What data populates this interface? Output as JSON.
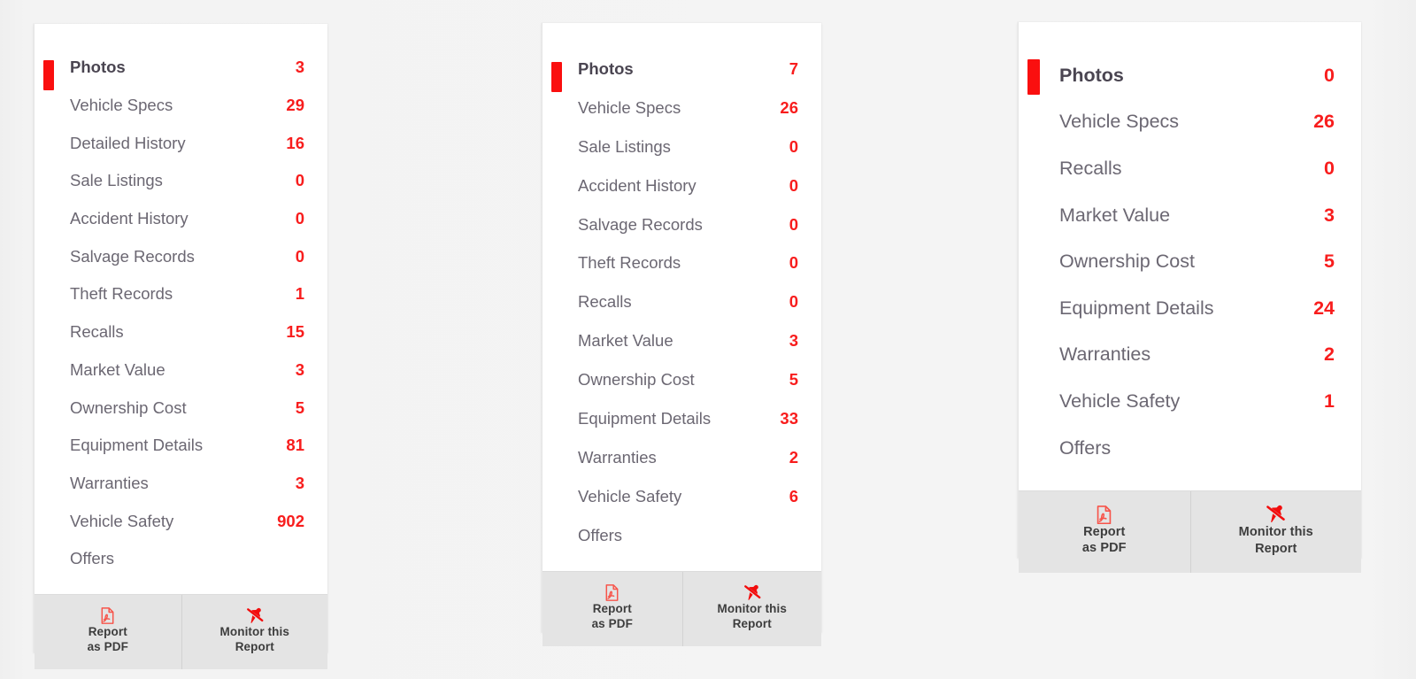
{
  "colors": {
    "accent_red": "#f81d1d",
    "marker_red": "#fa0f0f",
    "label_gray": "#6b6772",
    "active_label": "#4a4551",
    "panel_bg": "#ffffff",
    "page_bg": "#f2f2f2",
    "footer_bg": "#e4e4e4"
  },
  "footer": {
    "pdf": {
      "icon": "pdf-file-icon",
      "line1": "Report",
      "line2": "as PDF"
    },
    "monitor": {
      "icon": "pin-slash-icon",
      "line1": "Monitor this",
      "line2": "Report"
    }
  },
  "panels": [
    {
      "id": "panel-1",
      "active_index": 0,
      "rows": [
        {
          "label": "Photos",
          "count": "3"
        },
        {
          "label": "Vehicle Specs",
          "count": "29"
        },
        {
          "label": "Detailed History",
          "count": "16"
        },
        {
          "label": "Sale Listings",
          "count": "0"
        },
        {
          "label": "Accident History",
          "count": "0"
        },
        {
          "label": "Salvage Records",
          "count": "0"
        },
        {
          "label": "Theft Records",
          "count": "1"
        },
        {
          "label": "Recalls",
          "count": "15"
        },
        {
          "label": "Market Value",
          "count": "3"
        },
        {
          "label": "Ownership Cost",
          "count": "5"
        },
        {
          "label": "Equipment Details",
          "count": "81"
        },
        {
          "label": "Warranties",
          "count": "3"
        },
        {
          "label": "Vehicle Safety",
          "count": "902"
        },
        {
          "label": "Offers",
          "count": ""
        }
      ]
    },
    {
      "id": "panel-2",
      "active_index": 0,
      "rows": [
        {
          "label": "Photos",
          "count": "7"
        },
        {
          "label": "Vehicle Specs",
          "count": "26"
        },
        {
          "label": "Sale Listings",
          "count": "0"
        },
        {
          "label": "Accident History",
          "count": "0"
        },
        {
          "label": "Salvage Records",
          "count": "0"
        },
        {
          "label": "Theft Records",
          "count": "0"
        },
        {
          "label": "Recalls",
          "count": "0"
        },
        {
          "label": "Market Value",
          "count": "3"
        },
        {
          "label": "Ownership Cost",
          "count": "5"
        },
        {
          "label": "Equipment Details",
          "count": "33"
        },
        {
          "label": "Warranties",
          "count": "2"
        },
        {
          "label": "Vehicle Safety",
          "count": "6"
        },
        {
          "label": "Offers",
          "count": ""
        }
      ]
    },
    {
      "id": "panel-3",
      "active_index": 0,
      "rows": [
        {
          "label": "Photos",
          "count": "0"
        },
        {
          "label": "Vehicle Specs",
          "count": "26"
        },
        {
          "label": "Recalls",
          "count": "0"
        },
        {
          "label": "Market Value",
          "count": "3"
        },
        {
          "label": "Ownership Cost",
          "count": "5"
        },
        {
          "label": "Equipment Details",
          "count": "24"
        },
        {
          "label": "Warranties",
          "count": "2"
        },
        {
          "label": "Vehicle Safety",
          "count": "1"
        },
        {
          "label": "Offers",
          "count": ""
        }
      ]
    }
  ]
}
